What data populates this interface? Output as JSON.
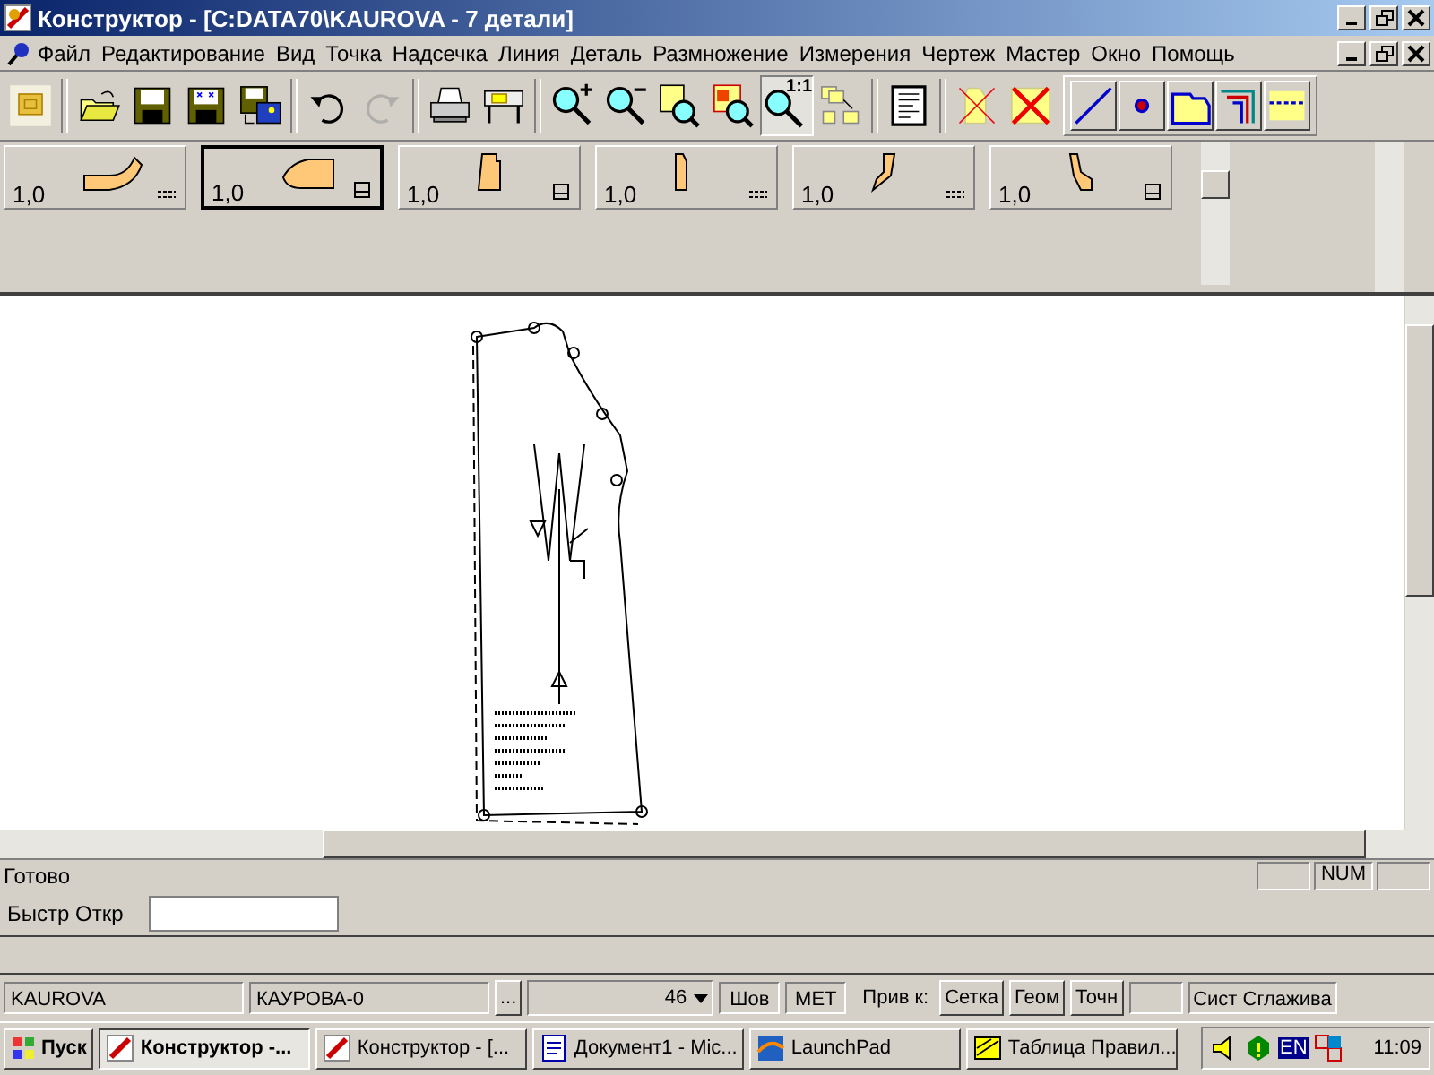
{
  "window": {
    "title": "Конструктор - [C:DATA70\\KAUROVA  - 7 детали]"
  },
  "menu": [
    "Файл",
    "Редактирование",
    "Вид",
    "Точка",
    "Надсечка",
    "Линия",
    "Деталь",
    "Размножение",
    "Измерения",
    "Чертеж",
    "Мастер",
    "Окно",
    "Помощь"
  ],
  "toolbar": [
    {
      "kind": "logo",
      "pressed": false,
      "disabled": false
    },
    {
      "kind": "sep"
    },
    {
      "kind": "open",
      "pressed": false,
      "disabled": false
    },
    {
      "kind": "save",
      "pressed": false,
      "disabled": false
    },
    {
      "kind": "save-close",
      "pressed": false,
      "disabled": false
    },
    {
      "kind": "save-image",
      "pressed": false,
      "disabled": false
    },
    {
      "kind": "sep"
    },
    {
      "kind": "undo",
      "pressed": false,
      "disabled": false
    },
    {
      "kind": "redo",
      "pressed": false,
      "disabled": true
    },
    {
      "kind": "sep"
    },
    {
      "kind": "print",
      "pressed": false,
      "disabled": false
    },
    {
      "kind": "plot",
      "pressed": false,
      "disabled": false
    },
    {
      "kind": "sep"
    },
    {
      "kind": "zoom-in",
      "pressed": false,
      "disabled": false
    },
    {
      "kind": "zoom-out",
      "pressed": false,
      "disabled": false
    },
    {
      "kind": "zoom-fit",
      "pressed": false,
      "disabled": false
    },
    {
      "kind": "zoom-area",
      "pressed": false,
      "disabled": false
    },
    {
      "kind": "zoom-actual",
      "label": "1:1",
      "pressed": true,
      "disabled": false
    },
    {
      "kind": "arrange",
      "pressed": false,
      "disabled": false
    },
    {
      "kind": "sep"
    },
    {
      "kind": "sheet",
      "pressed": false,
      "disabled": false
    },
    {
      "kind": "sep"
    },
    {
      "kind": "delete-piece",
      "pressed": false,
      "disabled": false
    },
    {
      "kind": "delete-all",
      "pressed": false,
      "disabled": false
    },
    {
      "kind": "group"
    },
    {
      "kind": "line",
      "pressed": false,
      "disabled": false
    },
    {
      "kind": "point",
      "pressed": false,
      "disabled": false
    },
    {
      "kind": "piece",
      "pressed": false,
      "disabled": false
    },
    {
      "kind": "seam",
      "pressed": false,
      "disabled": false
    },
    {
      "kind": "hem",
      "pressed": false,
      "disabled": false
    }
  ],
  "pieces": [
    {
      "label": "1,0",
      "selected": false
    },
    {
      "label": "1,0",
      "selected": true
    },
    {
      "label": "1,0",
      "selected": false
    },
    {
      "label": "1,0",
      "selected": false
    },
    {
      "label": "1,0",
      "selected": false
    },
    {
      "label": "1,0",
      "selected": false
    }
  ],
  "status_bar": {
    "text": "Готово",
    "indicator": "NUM"
  },
  "quick_open": {
    "label": "Быстр Откр"
  },
  "bottom_bar": {
    "file": "KAUROVA",
    "model": "КАУРОВА-0",
    "browse": "...",
    "size": "46",
    "seam": "Шов",
    "units": "МЕТ",
    "snap_label": "Прив к:",
    "snap_buttons": [
      "Сетка",
      "Геом",
      "Точн"
    ],
    "smoothing": "Сист Сглажива"
  },
  "taskbar": {
    "start": "Пуск",
    "tasks": [
      {
        "label": "Конструктор -...",
        "selected": true
      },
      {
        "label": "Конструктор - [...",
        "selected": false
      },
      {
        "label": "Документ1 - Mic...",
        "selected": false
      },
      {
        "label": "LaunchPad",
        "selected": false
      },
      {
        "label": "Таблица Правил...",
        "selected": false
      }
    ],
    "lang": "EN",
    "clock": "11:09"
  }
}
